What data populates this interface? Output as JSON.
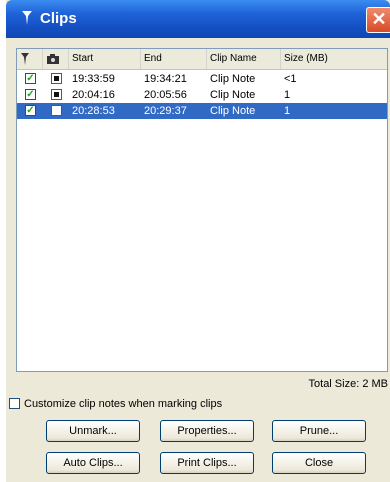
{
  "window": {
    "title": "Clips",
    "title_icon": "marker-icon",
    "close_label": "✕"
  },
  "columns": {
    "marker": "marker-icon",
    "snapshot": "camera-icon",
    "start": "Start",
    "end": "End",
    "clip_name": "Clip Name",
    "size": "Size (MB)"
  },
  "rows": [
    {
      "marked": true,
      "snap": "■",
      "start": "19:33:59",
      "end": "19:34:21",
      "clip_name": "Clip Note",
      "size": "<1",
      "selected": false
    },
    {
      "marked": true,
      "snap": "■",
      "start": "20:04:16",
      "end": "20:05:56",
      "clip_name": "Clip Note",
      "size": "1",
      "selected": false
    },
    {
      "marked": true,
      "snap": "",
      "start": "20:28:53",
      "end": "20:29:37",
      "clip_name": "Clip Note",
      "size": "1",
      "selected": true
    }
  ],
  "total_size": "Total Size: 2 MB",
  "customize_option": {
    "label": "Customize clip notes when marking clips",
    "checked": false
  },
  "buttons": {
    "unmark": "Unmark...",
    "properties": "Properties...",
    "prune": "Prune...",
    "auto_clips": "Auto Clips...",
    "print_clips": "Print Clips...",
    "close": "Close"
  },
  "colors": {
    "selection": "#316ac5",
    "titlebar": "#1f63d8",
    "face": "#ece9d8"
  }
}
